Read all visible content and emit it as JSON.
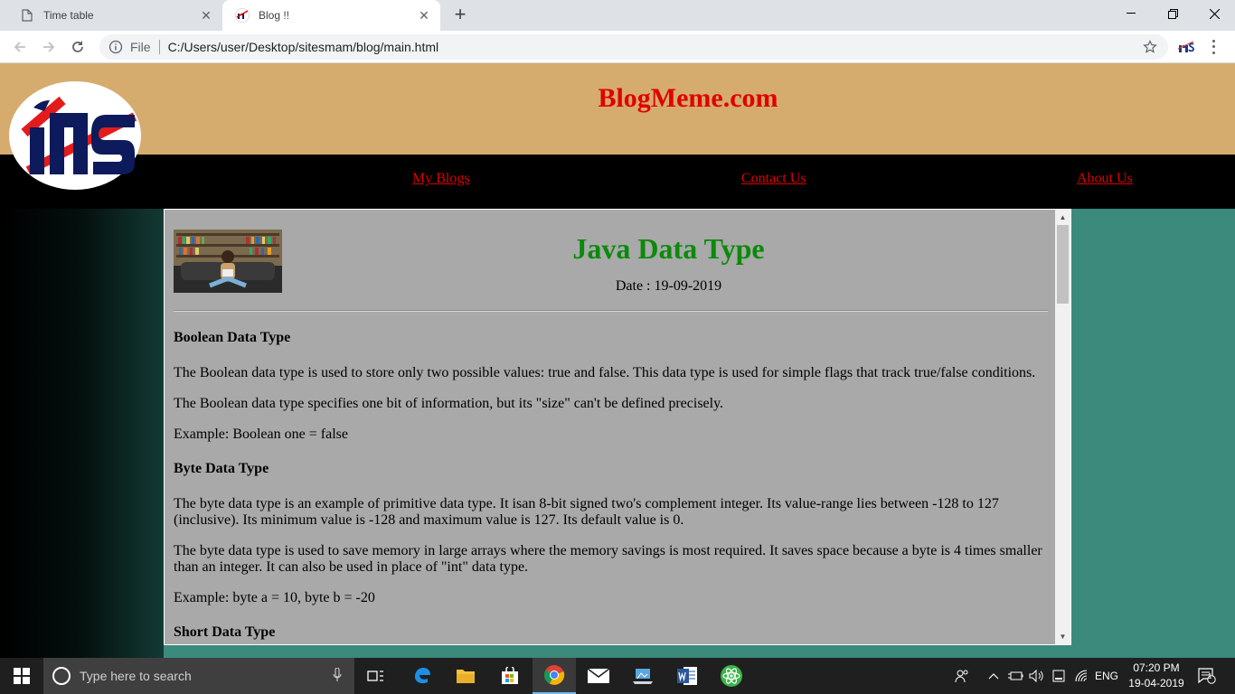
{
  "browser": {
    "tabs": [
      {
        "title": "Time table",
        "active": false
      },
      {
        "title": "Blog !!",
        "active": true
      }
    ],
    "address": {
      "scheme_label": "File",
      "url": "C:/Users/user/Desktop/sitesmam/blog/main.html"
    },
    "icons": [
      "back-icon",
      "forward-icon",
      "reload-icon",
      "info-icon",
      "star-icon",
      "extension-icon",
      "menu-icon",
      "minimize-icon",
      "restore-icon",
      "close-icon"
    ]
  },
  "site": {
    "title": "BlogMeme.com",
    "nav": [
      "My Blogs",
      "Contact Us",
      "About Us"
    ],
    "colors": {
      "header": "#d5ab6e",
      "title": "#e00000",
      "nav_bg": "#000000",
      "page_bg": "#3b8a7b",
      "post_title": "#0b8a0b",
      "content_bg": "#a9a9a9"
    }
  },
  "post": {
    "title": "Java Data Type",
    "date": "Date : 19-09-2019",
    "sections": [
      {
        "heading": "Boolean Data Type",
        "paragraphs": [
          "The Boolean data type is used to store only two possible values: true and false. This data type is used for simple flags that track true/false conditions.",
          "The Boolean data type specifies one bit of information, but its \"size\" can't be defined precisely.",
          "Example: Boolean one = false"
        ]
      },
      {
        "heading": "Byte Data Type",
        "paragraphs": [
          "The byte data type is an example of primitive data type. It isan 8-bit signed two's complement integer. Its value-range lies between -128 to 127 (inclusive). Its minimum value is -128 and maximum value is 127. Its default value is 0.",
          "The byte data type is used to save memory in large arrays where the memory savings is most required. It saves space because a byte is 4 times smaller than an integer. It can also be used in place of \"int\" data type.",
          "Example: byte a = 10, byte b = -20"
        ]
      },
      {
        "heading": "Short Data Type",
        "paragraphs": []
      }
    ]
  },
  "taskbar": {
    "search_placeholder": "Type here to search",
    "language": "ENG",
    "time": "07:20 PM",
    "date": "19-04-2019",
    "notification_count": "1",
    "apps": [
      "task-view-icon",
      "edge-icon",
      "file-explorer-icon",
      "store-icon",
      "chrome-icon",
      "mail-icon",
      "laptop-icon",
      "word-icon",
      "atom-icon"
    ]
  }
}
